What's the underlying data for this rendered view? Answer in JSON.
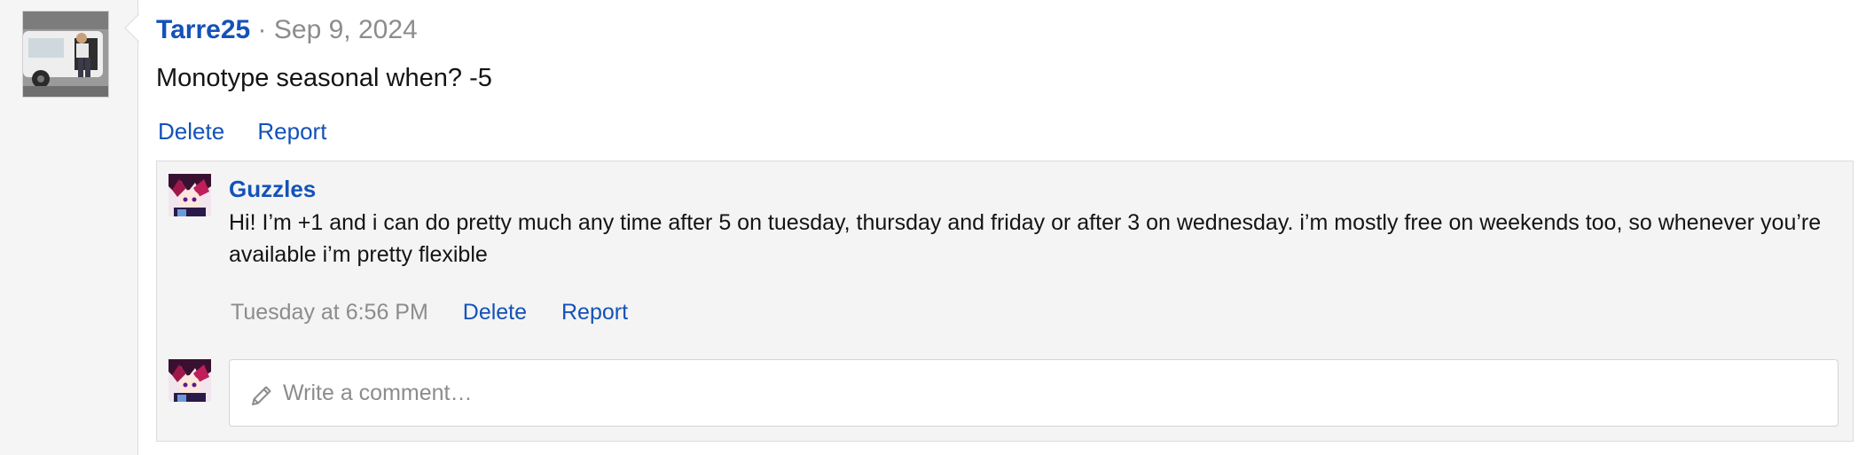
{
  "post": {
    "author": "Tarre25",
    "separator": "·",
    "date": "Sep 9, 2024",
    "message": "Monotype seasonal when? -5",
    "actions": {
      "delete": "Delete",
      "report": "Report"
    }
  },
  "reply": {
    "author": "Guzzles",
    "text": "Hi! I’m +1 and i can do pretty much any time after 5 on tuesday, thursday and friday or after 3 on wednesday. i’m mostly free on weekends too, so whenever you’re available i’m pretty flexible",
    "time": "Tuesday at 6:56 PM",
    "actions": {
      "delete": "Delete",
      "report": "Report"
    }
  },
  "comment_box": {
    "placeholder": "Write a comment…",
    "icon": "pencil-icon"
  },
  "colors": {
    "link": "#1452b8",
    "muted": "#8c8c8c",
    "panel_bg": "#f4f4f4",
    "border": "#dcdcdc"
  }
}
